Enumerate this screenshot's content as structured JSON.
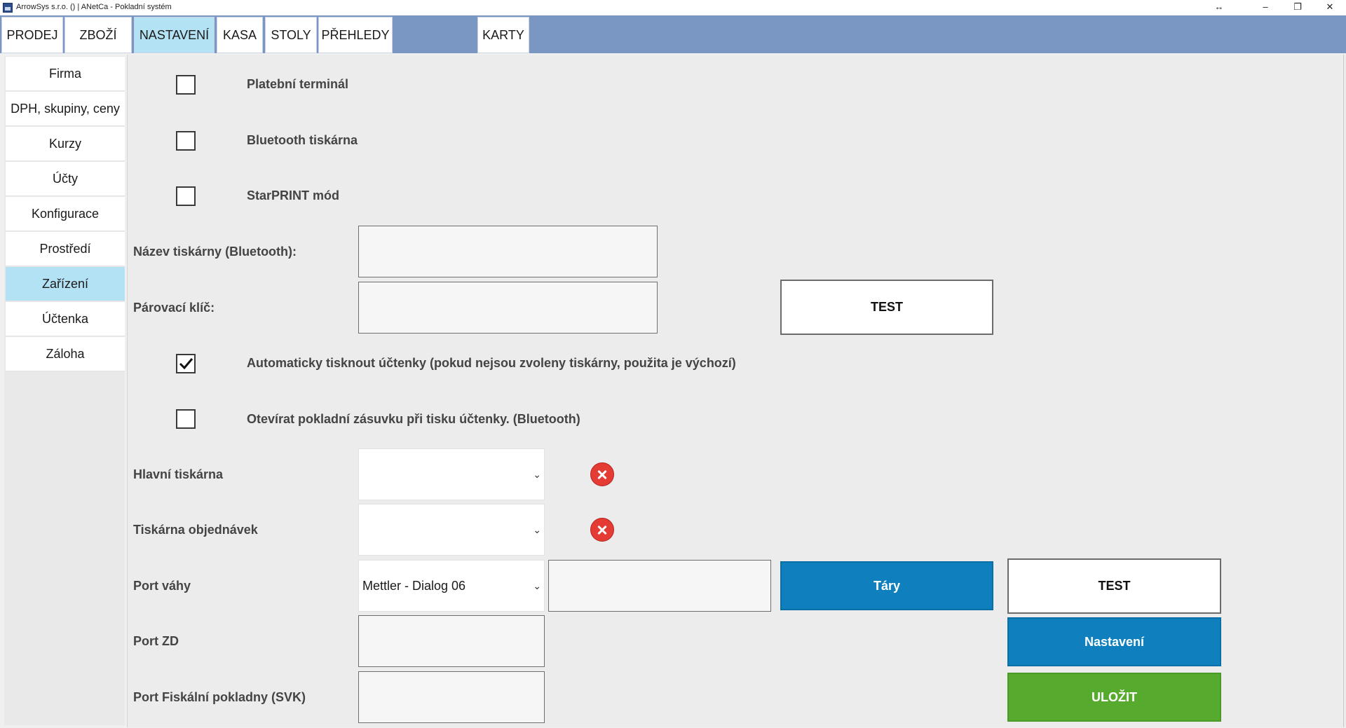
{
  "window": {
    "title": "ArrowSys s.r.o. () | ANetCa - Pokladní systém",
    "controls": {
      "resize": "↔",
      "minimize": "–",
      "maximize": "❐",
      "close": "✕"
    }
  },
  "top_tabs": [
    "PRODEJ",
    "ZBOŽÍ",
    "NASTAVENÍ",
    "KASA",
    "STOLY",
    "PŘEHLEDY",
    "KARTY"
  ],
  "active_top_tab": "NASTAVENÍ",
  "sidebar": {
    "items": [
      "Firma",
      "DPH, skupiny, ceny",
      "Kurzy",
      "Účty",
      "Konfigurace",
      "Prostředí",
      "Zařízení",
      "Účtenka",
      "Záloha"
    ],
    "active": "Zařízení"
  },
  "devices": {
    "payment_terminal": {
      "label": "Platební terminál",
      "checked": false
    },
    "bluetooth_printer": {
      "label": "Bluetooth tiskárna",
      "checked": false
    },
    "starprint_mode": {
      "label": "StarPRINT mód",
      "checked": false
    },
    "printer_name": {
      "label": "Název tiskárny (Bluetooth):",
      "value": ""
    },
    "pairing_key": {
      "label": "Párovací klíč:",
      "value": ""
    },
    "test_button": "TEST",
    "auto_print": {
      "label": "Automaticky tisknout účtenky (pokud nejsou zvoleny tiskárny, použita je výchozí)",
      "checked": true
    },
    "open_drawer": {
      "label": "Otevírat pokladní zásuvku při tisku účtenky. (Bluetooth)",
      "checked": false
    },
    "main_printer": {
      "label": "Hlavní tiskárna",
      "value": ""
    },
    "order_printer": {
      "label": "Tiskárna objednávek",
      "value": ""
    },
    "scale_port": {
      "label": "Port váhy",
      "value": "Mettler - Dialog 06",
      "port_value": ""
    },
    "tare_button": "Táry",
    "scale_test_button": "TEST",
    "zd_port": {
      "label": "Port ZD",
      "value": ""
    },
    "settings_button": "Nastavení",
    "fiscal_port": {
      "label": "Port Fiskální pokladny (SVK)",
      "value": ""
    },
    "save_button": "ULOŽIT"
  },
  "colors": {
    "top_bar": "#7a96c2",
    "active_tab": "#b4e2f5",
    "primary_blue": "#0f80bd",
    "save_green": "#56ab2f",
    "clear_red": "#e53b35"
  }
}
